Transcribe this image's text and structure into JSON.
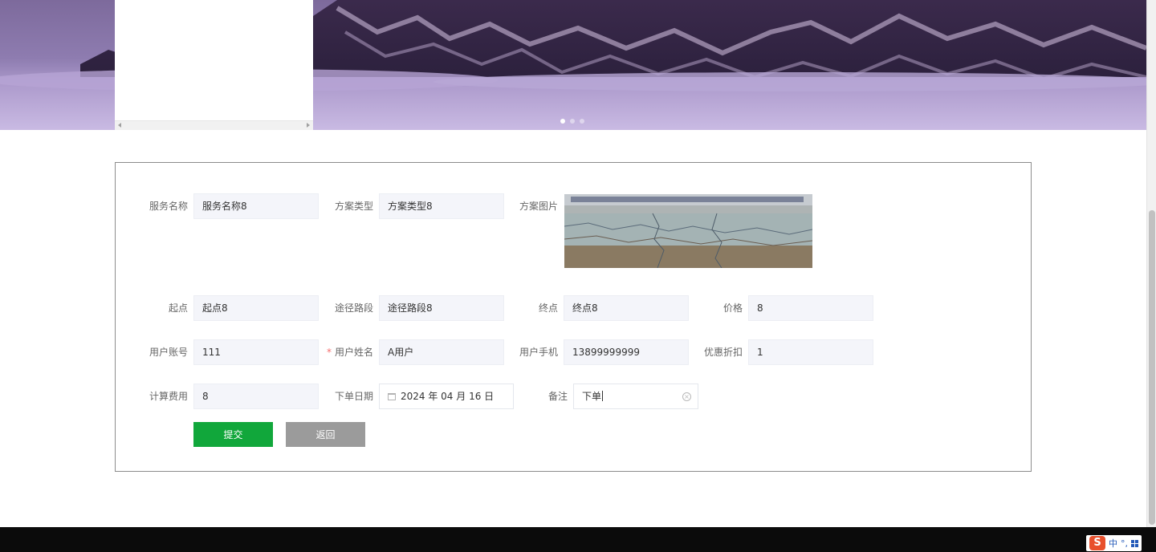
{
  "banner": {
    "dots": [
      true,
      false,
      false
    ]
  },
  "form": {
    "service_name": {
      "label": "服务名称",
      "value": "服务名称8"
    },
    "plan_type": {
      "label": "方案类型",
      "value": "方案类型8"
    },
    "plan_image": {
      "label": "方案图片"
    },
    "start_point": {
      "label": "起点",
      "value": "起点8"
    },
    "route_section": {
      "label": "途径路段",
      "value": "途径路段8"
    },
    "end_point": {
      "label": "终点",
      "value": "终点8"
    },
    "price": {
      "label": "价格",
      "value": "8"
    },
    "user_account": {
      "label": "用户账号",
      "value": "111"
    },
    "user_name": {
      "label": "用户姓名",
      "value": "A用户",
      "required_mark": "*"
    },
    "user_phone": {
      "label": "用户手机",
      "value": "13899999999"
    },
    "discount": {
      "label": "优惠折扣",
      "value": "1"
    },
    "calc_fee": {
      "label": "计算费用",
      "value": "8"
    },
    "order_date": {
      "label": "下单日期",
      "value": "2024 年 04 月 16 日"
    },
    "remark": {
      "label": "备注",
      "value": "下单"
    },
    "buttons": {
      "submit": "提交",
      "back": "返回"
    }
  },
  "ime": {
    "logo": "S",
    "mode": "中",
    "punct": "°,"
  },
  "colors": {
    "submit": "#11a73b",
    "back": "#9b9b9b",
    "required": "#f56c6c",
    "footer": "#0b0b0b"
  }
}
